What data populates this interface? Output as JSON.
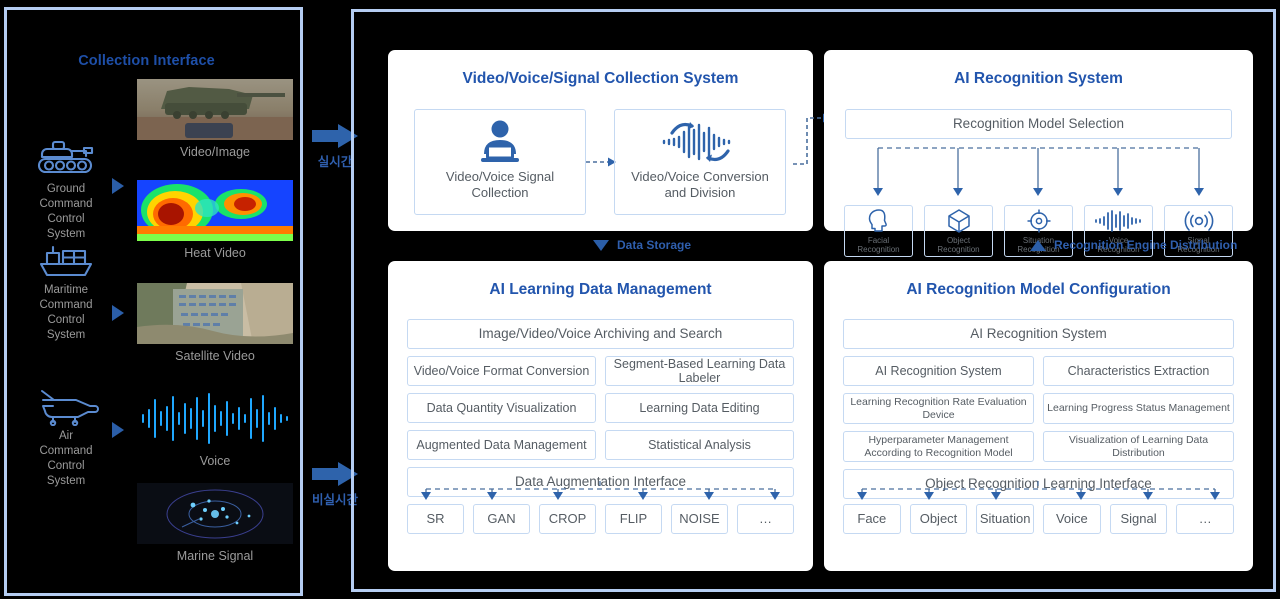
{
  "left_panel": {
    "title": "Collection Interface",
    "sources": [
      {
        "icon": "tank-icon",
        "label": "Ground\nCommand\nControl\nSystem"
      },
      {
        "icon": "ship-icon",
        "label": "Maritime\nCommand\nControl\nSystem"
      },
      {
        "icon": "airplane-icon",
        "label": "Air\nCommand\nControl\nSystem"
      }
    ],
    "source_labels": [
      [
        "Ground",
        "Command",
        "Control",
        "System"
      ],
      [
        "Maritime",
        "Command",
        "Control",
        "System"
      ],
      [
        "Air",
        "Command",
        "Control",
        "System"
      ]
    ],
    "thumbnails": [
      {
        "caption": "Video/Image",
        "kind": "tank-photo"
      },
      {
        "caption": "Heat Video",
        "kind": "thermal-photo"
      },
      {
        "caption": "Satellite Video",
        "kind": "satellite-photo"
      },
      {
        "caption": "Voice",
        "kind": "waveform-photo"
      },
      {
        "caption": "Marine Signal",
        "kind": "radar-photo"
      }
    ]
  },
  "connectors": [
    {
      "label": "실시간",
      "icon": "right-arrow-icon"
    },
    {
      "label": "비실시간",
      "icon": "right-arrow-icon"
    }
  ],
  "collection_system": {
    "title": "Video/Voice/Signal Collection System",
    "cards": [
      {
        "icon": "person-laptop-icon",
        "label": "Video/Voice Signal\nCollection",
        "line1": "Video/Voice Signal",
        "line2": "Collection"
      },
      {
        "icon": "waveform-loop-icon",
        "label": "Video/Voice Conversion\nand Division",
        "line1": "Video/Voice Conversion",
        "line2": "and Division"
      }
    ]
  },
  "recognition_system": {
    "title": "AI Recognition System",
    "selector": "Recognition Model Selection",
    "engines": [
      {
        "icon": "head-profile-icon",
        "line1": "Facial",
        "line2": "Recognition"
      },
      {
        "icon": "cube-icon",
        "line1": "Object",
        "line2": "Recognition"
      },
      {
        "icon": "target-icon",
        "line1": "Situation",
        "line2": "Recognition"
      },
      {
        "icon": "waveform-icon",
        "line1": "Voice",
        "line2": "Recognition"
      },
      {
        "icon": "signal-waves-icon",
        "line1": "Signal",
        "line2": "Recognition"
      }
    ]
  },
  "band": {
    "data_storage": "Data Storage",
    "engine_distribution": "Recognition Engine Distribution"
  },
  "learning_panel": {
    "title": "AI Learning Data Management",
    "header_row": "Image/Video/Voice Archiving and Search",
    "pairs": [
      [
        "Video/Voice Format Conversion",
        "Segment-Based Learning Data Labeler"
      ],
      [
        "Data Quantity Visualization",
        "Learning Data Editing"
      ],
      [
        "Augmented Data Management",
        "Statistical Analysis"
      ]
    ],
    "footer_row": "Data Augmentation Interface",
    "leaves": [
      "SR",
      "GAN",
      "CROP",
      "FLIP",
      "NOISE",
      "…"
    ]
  },
  "model_config_panel": {
    "title": "AI Recognition Model Configuration",
    "header_row": "AI Recognition System",
    "pairs": [
      [
        "AI Recognition System",
        "Characteristics Extraction"
      ],
      [
        "Learning Recognition Rate Evaluation Device",
        "Learning Progress Status Management"
      ],
      [
        "Hyperparameter Management According to Recognition Model",
        "Visualization of Learning Data Distribution"
      ]
    ],
    "footer_row": "Object Recognition Learning Interface",
    "leaves": [
      "Face",
      "Object",
      "Situation",
      "Voice",
      "Signal",
      "…"
    ]
  },
  "colors": {
    "background": "#000000",
    "frame_border": "#b5cdf2",
    "title_blue": "#2255ad",
    "accent_blue": "#2b5ea8",
    "box_border": "#c5d9f2",
    "box_text": "#555c63",
    "caption_gray": "#9b9b9b"
  }
}
